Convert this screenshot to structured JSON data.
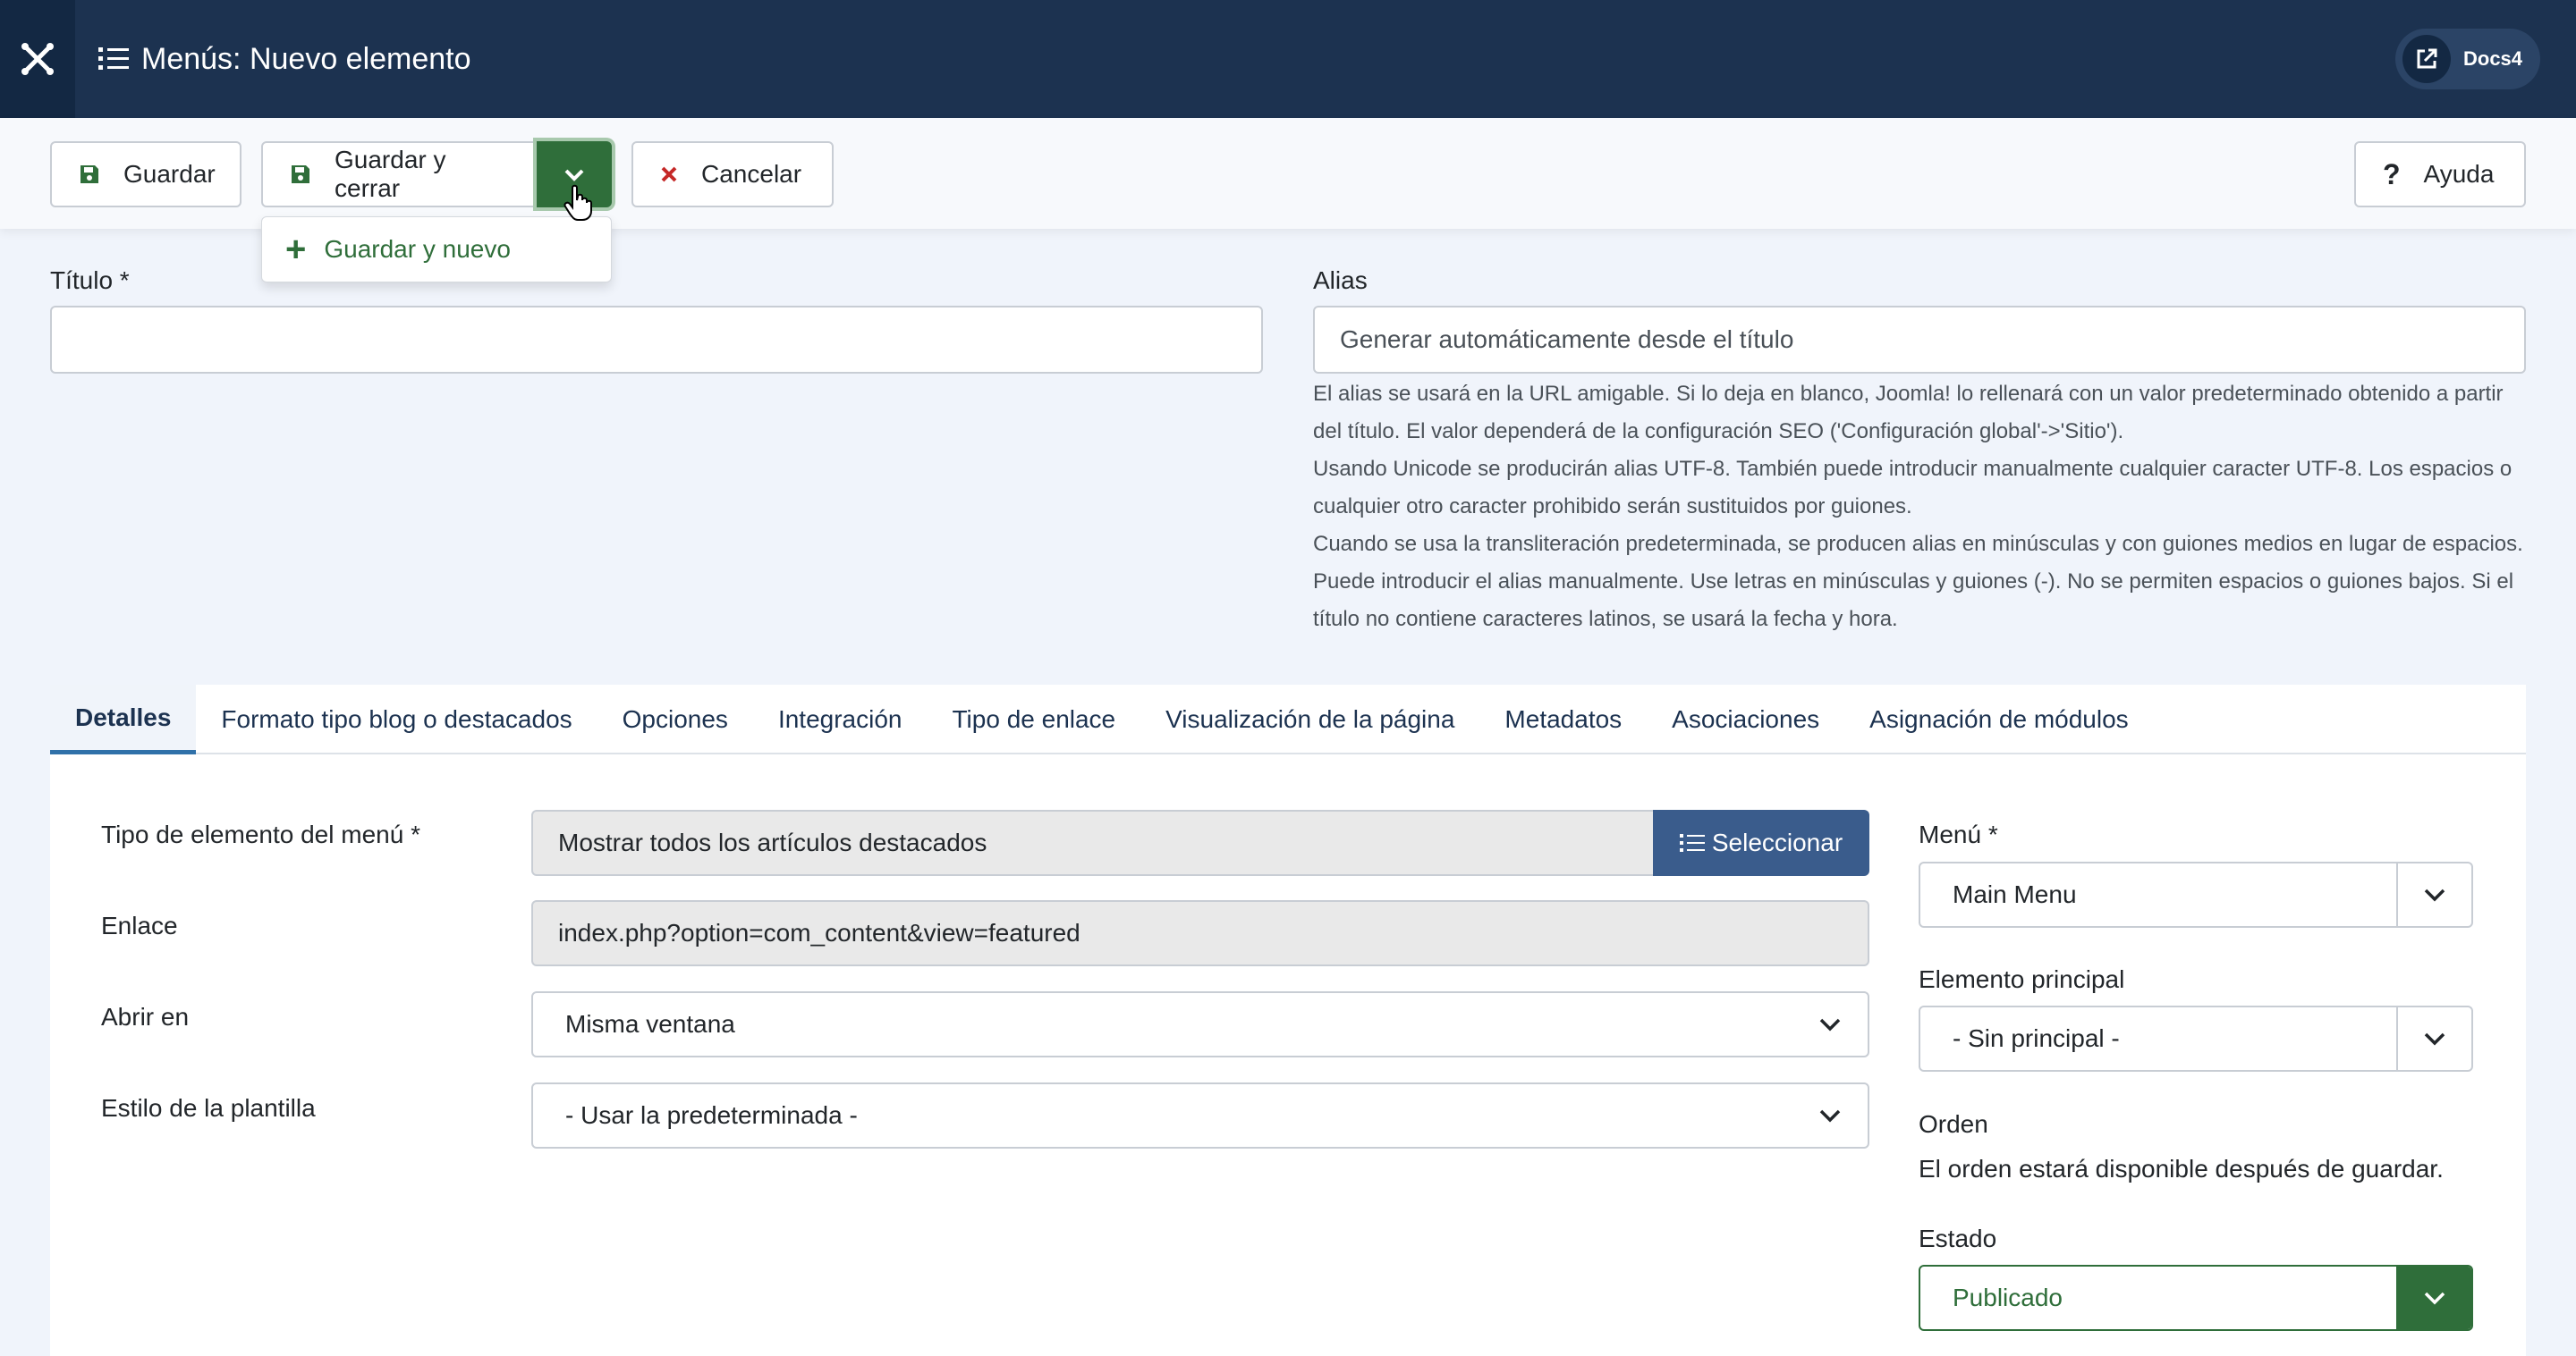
{
  "header": {
    "title": "Menús: Nuevo elemento",
    "user_label": "Docs4"
  },
  "toolbar": {
    "save_label": "Guardar",
    "save_close_label": "Guardar y cerrar",
    "cancel_label": "Cancelar",
    "help_label": "Ayuda",
    "dropdown_item": "Guardar y nuevo"
  },
  "form": {
    "title_label": "Título *",
    "title_value": "",
    "alias_label": "Alias",
    "alias_placeholder": "Generar automáticamente desde el título",
    "alias_help": [
      "El alias se usará en la URL amigable. Si lo deja en blanco, Joomla! lo rellenará con un valor predeterminado obtenido a partir del título. El valor dependerá de la configuración SEO ('Configuración global'->'Sitio').",
      "Usando Unicode se producirán alias UTF-8. También puede introducir manualmente cualquier caracter UTF-8. Los espacios o cualquier otro caracter prohibido serán sustituidos por guiones.",
      "Cuando se usa la transliteración predeterminada, se producen alias en minúsculas y con guiones medios en lugar de espacios. Puede introducir el alias manualmente. Use letras en minúsculas y guiones (-). No se permiten espacios o guiones bajos. Si el título no contiene caracteres latinos, se usará la fecha y hora."
    ]
  },
  "tabs": [
    {
      "label": "Detalles",
      "active": true
    },
    {
      "label": "Formato tipo blog o destacados"
    },
    {
      "label": "Opciones"
    },
    {
      "label": "Integración"
    },
    {
      "label": "Tipo de enlace"
    },
    {
      "label": "Visualización de la página"
    },
    {
      "label": "Metadatos"
    },
    {
      "label": "Asociaciones"
    },
    {
      "label": "Asignación de módulos"
    }
  ],
  "details": {
    "type_label": "Tipo de elemento del menú *",
    "type_value": "Mostrar todos los artículos destacados",
    "select_button": "Seleccionar",
    "link_label": "Enlace",
    "link_value": "index.php?option=com_content&view=featured",
    "open_label": "Abrir en",
    "open_value": "Misma ventana",
    "style_label": "Estilo de la plantilla",
    "style_value": "- Usar la predeterminada -"
  },
  "sidebar": {
    "menu_label": "Menú *",
    "menu_value": "Main Menu",
    "parent_label": "Elemento principal",
    "parent_value": "- Sin principal -",
    "order_label": "Orden",
    "order_text": "El orden estará disponible después de guardar.",
    "status_label": "Estado",
    "status_value": "Publicado"
  },
  "colors": {
    "header_bg": "#1c3250",
    "accent_green": "#2f6e3a",
    "select_blue": "#3a5c8c",
    "danger_red": "#c52827"
  }
}
